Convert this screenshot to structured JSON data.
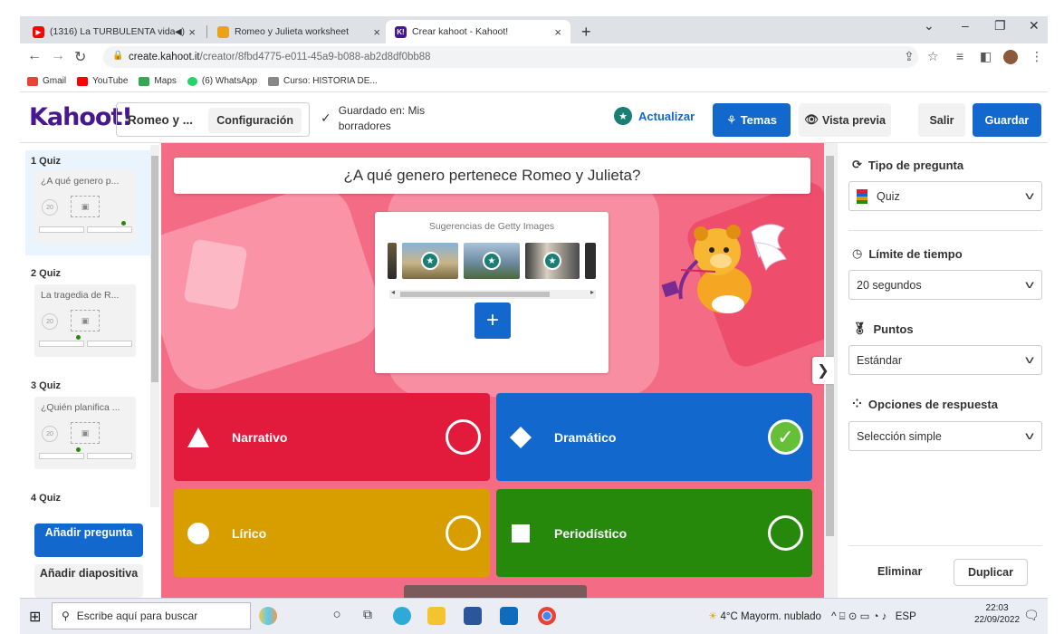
{
  "browser": {
    "tabs": [
      {
        "label": "(1316) La TURBULENTA vida",
        "color": "#ff0000"
      },
      {
        "label": "Romeo y Julieta worksheet",
        "color": "#e8a317"
      },
      {
        "label": "Crear kahoot - Kahoot!",
        "color": "#46178f"
      }
    ],
    "url_domain": "create.kahoot.it",
    "url_path": "/creator/8fbd4775-e011-45a9-b088-ab2d8df0bb88",
    "bookmarks": [
      {
        "label": "Gmail",
        "color": "#ea4335"
      },
      {
        "label": "YouTube",
        "color": "#ff0000"
      },
      {
        "label": "Maps",
        "color": "#34a853"
      },
      {
        "label": "(6) WhatsApp",
        "color": "#25d366"
      },
      {
        "label": "Curso: HISTORIA DE...",
        "color": "#888888"
      }
    ]
  },
  "header": {
    "logo": "Kahoot!",
    "title": "Romeo y ...",
    "config_label": "Configuración",
    "saved_line1": "Guardado en: Mis",
    "saved_line2": "borradores",
    "update_label": "Actualizar",
    "themes_label": "Temas",
    "preview_label": "Vista previa",
    "exit_label": "Salir",
    "save_label": "Guardar"
  },
  "sidebar": {
    "slides": [
      {
        "label": "1 Quiz",
        "title": "¿A qué genero p...",
        "time": "20"
      },
      {
        "label": "2 Quiz",
        "title": "La tragedia de R...",
        "time": "20"
      },
      {
        "label": "3 Quiz",
        "title": "¿Quién planifica ...",
        "time": "20"
      },
      {
        "label": "4 Quiz"
      }
    ],
    "add_question": "Añadir pregunta",
    "add_slide": "Añadir diapositiva"
  },
  "question": {
    "title": "¿A qué genero pertenece Romeo y Julieta?",
    "media_caption": "Sugerencias de Getty Images",
    "answers": [
      {
        "label": "Narrativo",
        "color": "#e21b3c",
        "shape": "triangle",
        "correct": false
      },
      {
        "label": "Dramático",
        "color": "#1368ce",
        "shape": "diamond",
        "correct": true
      },
      {
        "label": "Lírico",
        "color": "#d89e00",
        "shape": "circle",
        "correct": false
      },
      {
        "label": "Periodístico",
        "color": "#26890c",
        "shape": "square",
        "correct": false
      }
    ]
  },
  "panel": {
    "type_label": "Tipo de pregunta",
    "type_value": "Quiz",
    "time_label": "Límite de tiempo",
    "time_value": "20 segundos",
    "points_label": "Puntos",
    "points_value": "Estándar",
    "options_label": "Opciones de respuesta",
    "options_value": "Selección simple",
    "delete_label": "Eliminar",
    "duplicate_label": "Duplicar"
  },
  "taskbar": {
    "search_placeholder": "Escribe aquí para buscar",
    "weather": "4°C  Mayorm. nublado",
    "lang": "ESP",
    "time": "22:03",
    "date": "22/09/2022"
  }
}
